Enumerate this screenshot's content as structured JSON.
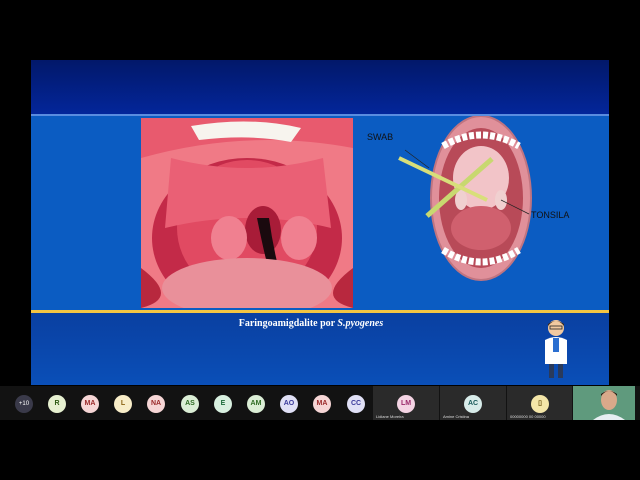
{
  "slide": {
    "label_swab": "SWAB",
    "label_tonsila": "TONSILA",
    "caption_main": "Faringoamigdalite por ",
    "caption_species": "S.pyogenes"
  },
  "participants": {
    "more_count": "+10",
    "avatars": [
      {
        "initials": "R",
        "bg": "#e6f0d0",
        "fg": "#2d5a12"
      },
      {
        "initials": "MA",
        "bg": "#f6d6d6",
        "fg": "#9a2a2a"
      },
      {
        "initials": "L",
        "bg": "#f8edc8",
        "fg": "#8a6212"
      },
      {
        "initials": "NA",
        "bg": "#f6d6d6",
        "fg": "#9a2a2a"
      },
      {
        "initials": "AS",
        "bg": "#dbeed6",
        "fg": "#2d6a22"
      },
      {
        "initials": "E",
        "bg": "#d8f0e0",
        "fg": "#1a6a3a"
      },
      {
        "initials": "AM",
        "bg": "#dbeed6",
        "fg": "#2d6a22"
      },
      {
        "initials": "AO",
        "bg": "#e0e0f6",
        "fg": "#3a3a9a"
      },
      {
        "initials": "MA",
        "bg": "#f6d6d6",
        "fg": "#9a2a2a"
      },
      {
        "initials": "CC",
        "bg": "#e0e0f6",
        "fg": "#3a3a9a"
      }
    ],
    "tiles": [
      {
        "initials": "LM",
        "name": "Lidiane Moreira",
        "bg": "#f4d4e4",
        "fg": "#9a2a6a"
      },
      {
        "initials": "AC",
        "name": "Amine Cristina",
        "bg": "#d8ecea",
        "fg": "#1a5a5a"
      },
      {
        "initials": "▯",
        "name": "00000000 00 00000",
        "bg": "#f4e6a8",
        "fg": "#6a5210"
      }
    ]
  },
  "colors": {
    "slide_bg": "#0b5cc2",
    "header_bg": "#02186a",
    "accent_line": "#f4c542"
  }
}
